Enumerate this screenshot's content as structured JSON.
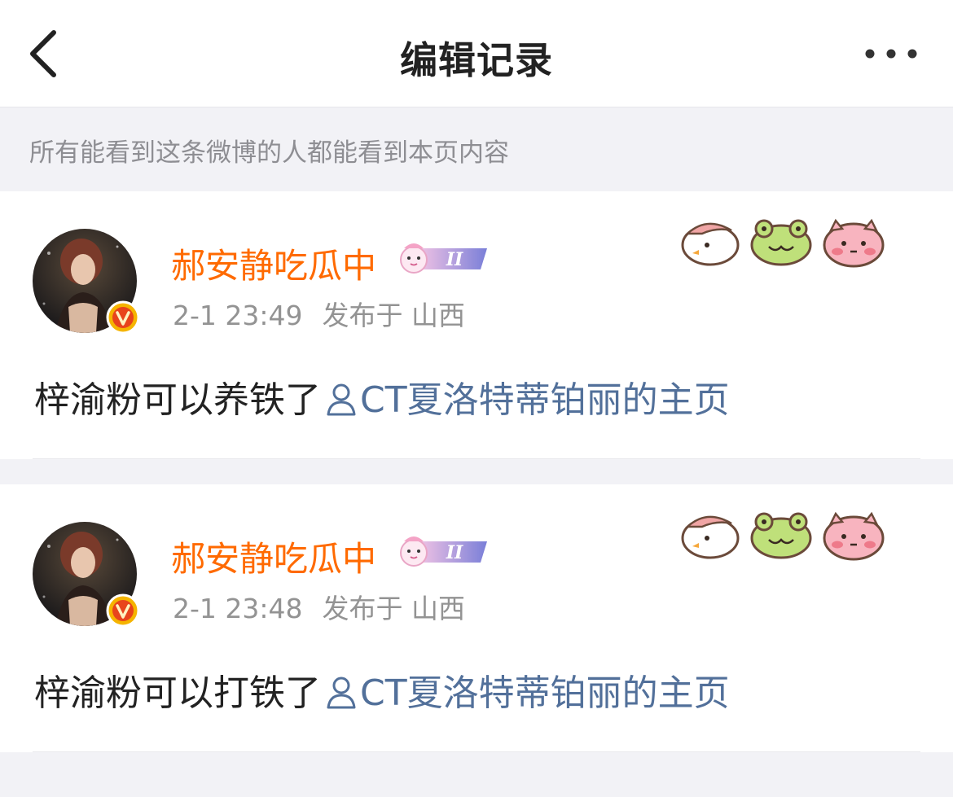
{
  "nav": {
    "title": "编辑记录",
    "back_icon": "chevron-left-icon",
    "more_icon": "more-horizontal-icon"
  },
  "notice": {
    "text": "所有能看到这条微博的人都能看到本页内容"
  },
  "colors": {
    "username": "#ff6a00",
    "link": "#52709a",
    "meta": "#939393",
    "page_bg": "#f2f2f6",
    "verified": "#f0a000"
  },
  "records": [
    {
      "username": "郝安静吃瓜中",
      "time": "2-1 23:49",
      "location": "发布于 山西",
      "text": "梓渝粉可以养铁了",
      "link_text": "CT夏洛特蒂铂丽的主页",
      "badge_text": "II"
    },
    {
      "username": "郝安静吃瓜中",
      "time": "2-1 23:48",
      "location": "发布于 山西",
      "text": "梓渝粉可以打铁了",
      "link_text": "CT夏洛特蒂铂丽的主页",
      "badge_text": "II"
    }
  ]
}
